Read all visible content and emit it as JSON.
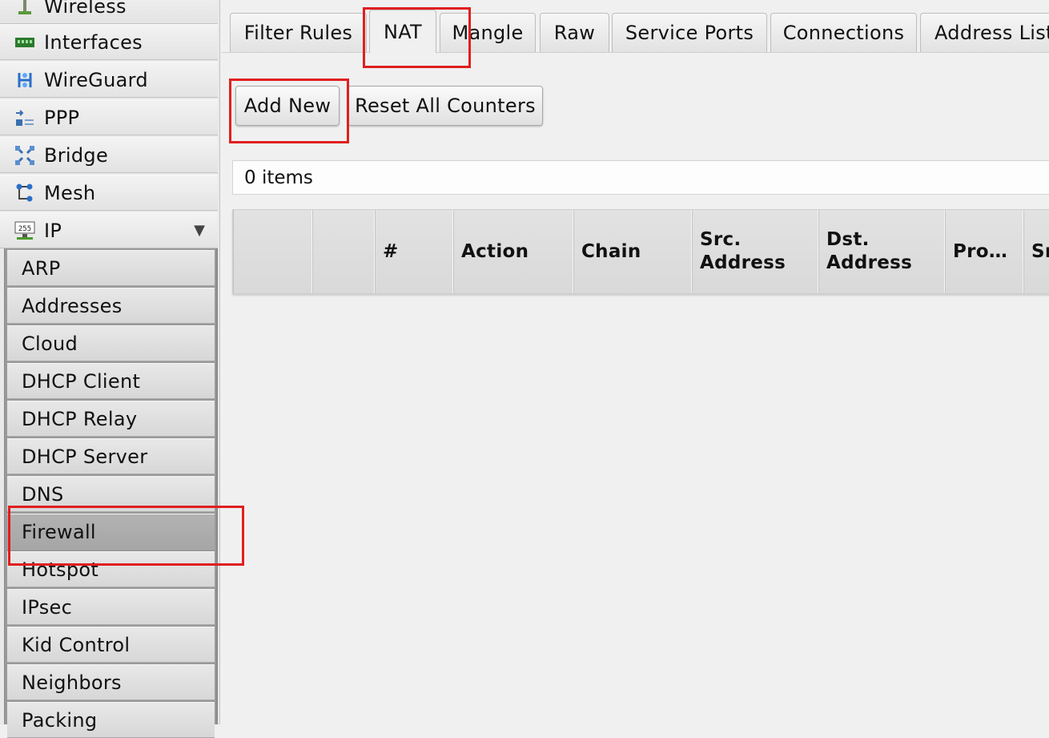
{
  "sidebar": {
    "items": [
      {
        "label": "Wireless",
        "icon": "wireless-icon"
      },
      {
        "label": "Interfaces",
        "icon": "interfaces-icon"
      },
      {
        "label": "WireGuard",
        "icon": "wireguard-icon"
      },
      {
        "label": "PPP",
        "icon": "ppp-icon"
      },
      {
        "label": "Bridge",
        "icon": "bridge-icon"
      },
      {
        "label": "Mesh",
        "icon": "mesh-icon"
      },
      {
        "label": "IP",
        "icon": "ip-icon",
        "expanded": true
      }
    ],
    "ip_submenu": [
      {
        "label": "ARP"
      },
      {
        "label": "Addresses"
      },
      {
        "label": "Cloud"
      },
      {
        "label": "DHCP Client"
      },
      {
        "label": "DHCP Relay"
      },
      {
        "label": "DHCP Server"
      },
      {
        "label": "DNS"
      },
      {
        "label": "Firewall",
        "active": true
      },
      {
        "label": "Hotspot"
      },
      {
        "label": "IPsec"
      },
      {
        "label": "Kid Control"
      },
      {
        "label": "Neighbors"
      },
      {
        "label": "Packing"
      }
    ]
  },
  "tabs": [
    {
      "label": "Filter Rules"
    },
    {
      "label": "NAT",
      "active": true
    },
    {
      "label": "Mangle"
    },
    {
      "label": "Raw"
    },
    {
      "label": "Service Ports"
    },
    {
      "label": "Connections"
    },
    {
      "label": "Address Lists"
    }
  ],
  "toolbar": {
    "add_new": "Add New",
    "reset_counters": "Reset All Counters"
  },
  "list": {
    "count_text": "0 items"
  },
  "table": {
    "columns": [
      "",
      "",
      "#",
      "Action",
      "Chain",
      "Src. Address",
      "Dst. Address",
      "Pro…",
      "Src. Port"
    ]
  },
  "colors": {
    "highlight": "#e01f1f"
  }
}
